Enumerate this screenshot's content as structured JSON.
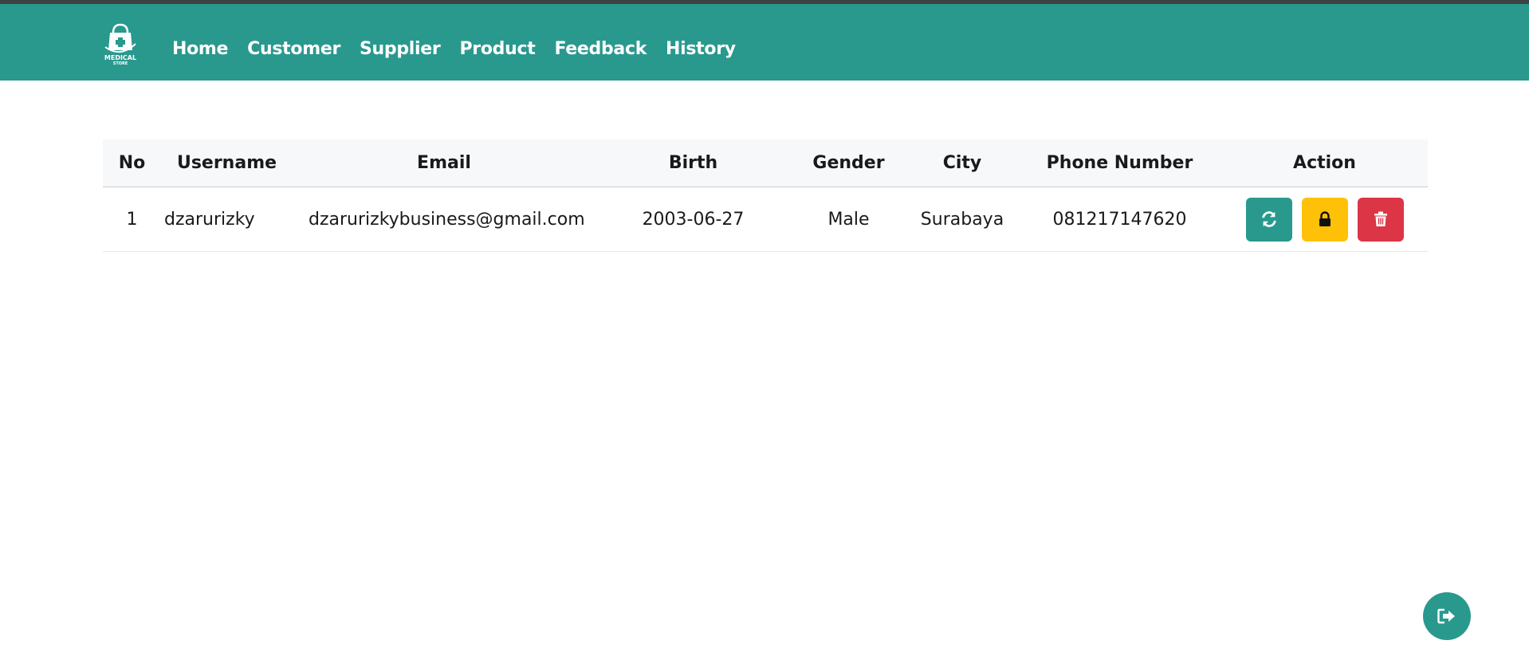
{
  "brand": {
    "logo_text": "MEDICAL",
    "logo_subtext": "STORE"
  },
  "nav": {
    "items": [
      {
        "label": "Home"
      },
      {
        "label": "Customer"
      },
      {
        "label": "Supplier"
      },
      {
        "label": "Product"
      },
      {
        "label": "Feedback"
      },
      {
        "label": "History"
      }
    ]
  },
  "table": {
    "headers": [
      "No",
      "Username",
      "Email",
      "Birth",
      "Gender",
      "City",
      "Phone Number",
      "Action"
    ],
    "rows": [
      {
        "no": "1",
        "username": "dzarurizky",
        "email": "dzarurizkybusiness@gmail.com",
        "birth": "2003-06-27",
        "gender": "Male",
        "city": "Surabaya",
        "phone": "081217147620"
      }
    ]
  },
  "actions": {
    "update_icon": "refresh-icon",
    "lock_icon": "lock-icon",
    "delete_icon": "trash-icon"
  },
  "logout": {
    "icon": "sign-out-icon"
  },
  "colors": {
    "primary": "#29998e",
    "warning": "#ffc107",
    "danger": "#dc3545",
    "topline": "#3d4144"
  }
}
